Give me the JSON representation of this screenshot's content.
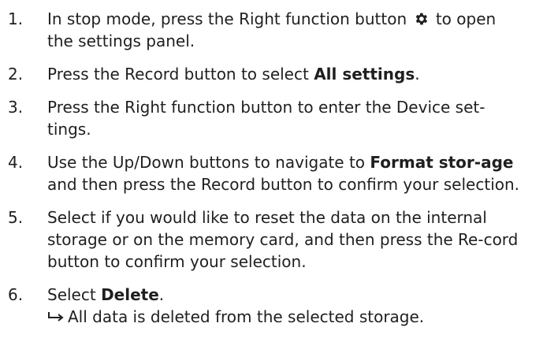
{
  "steps": [
    {
      "number": "1.",
      "text_before": "In stop mode, press the Right function button",
      "icon": "gear-icon",
      "text_after": "to open the settings panel."
    },
    {
      "number": "2.",
      "text_before": "Press the Record button to select ",
      "bold": "All settings",
      "text_after": "."
    },
    {
      "number": "3.",
      "text": "Press the Right function button to enter the Device set-tings."
    },
    {
      "number": "4.",
      "text_before": "Use the Up/Down buttons to navigate to ",
      "bold": "Format stor-age",
      "text_after": " and then press the Record button to confirm your selection."
    },
    {
      "number": "5.",
      "text": "Select if you would like to reset the data on the internal storage or on the memory card, and then press the Re-cord button to confirm your selection."
    },
    {
      "number": "6.",
      "text_before": "Select ",
      "bold": "Delete",
      "text_after": ".",
      "result_icon": "right-hook-arrow-icon",
      "result": "All data is deleted from the selected storage."
    }
  ]
}
